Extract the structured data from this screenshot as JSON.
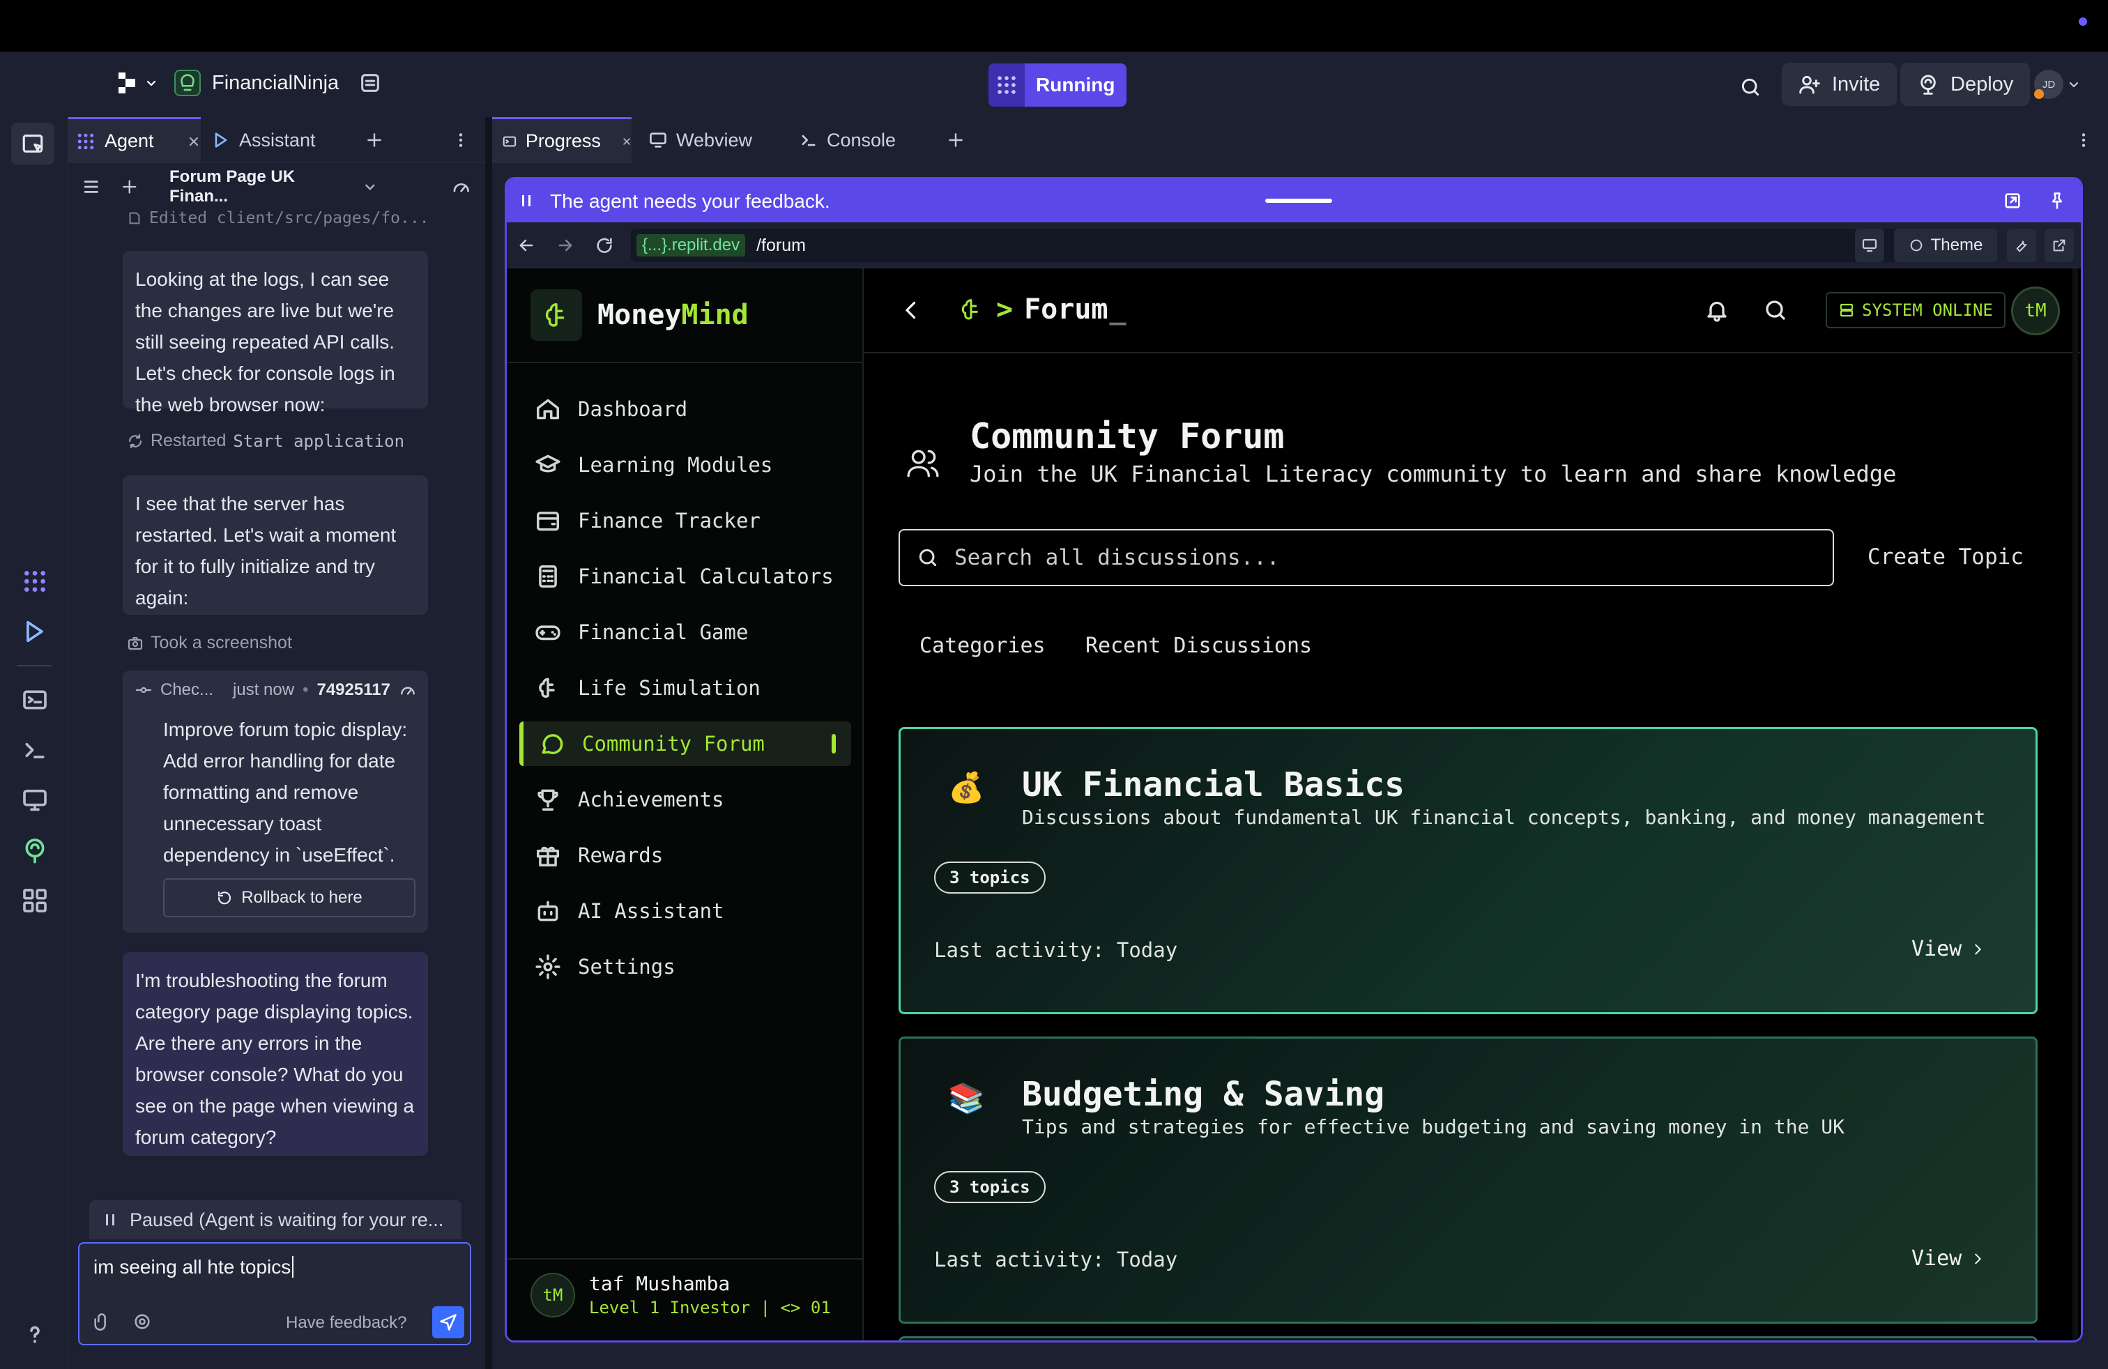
{
  "app": {
    "project_name": "FinancialNinja",
    "status": "Running",
    "invite_label": "Invite",
    "deploy_label": "Deploy",
    "avatar_initials": "JD"
  },
  "chat": {
    "tabs": [
      {
        "label": "Agent"
      },
      {
        "label": "Assistant"
      }
    ],
    "thread_title": "Forum Page UK Finan...",
    "edited_note": "Edited client/src/pages/fo...",
    "messages": [
      {
        "text": "Looking at the logs, I can see the changes are live but we're still seeing repeated API calls. Let's check for console logs in the web browser now:"
      },
      {
        "text": "I see that the server has restarted. Let's wait a moment for it to fully initialize and try again:"
      }
    ],
    "restarted": {
      "prefix": "Restarted",
      "name": "Start application"
    },
    "screenshot_note": "Took a screenshot",
    "checkpoint": {
      "label": "Chec...",
      "time": "just now",
      "id": "74925117",
      "text": "Improve forum topic display: Add error handling for date formatting and remove unnecessary toast dependency in `useEffect`.",
      "rollback_label": "Rollback to here"
    },
    "user_message": "I'm troubleshooting the forum category page displaying topics. Are there any errors in the browser console? What do you see on the page when viewing a forum category?",
    "paused_text": "Paused (Agent is waiting for your re...",
    "input_value": "im seeing all hte topics",
    "feedback_label": "Have feedback?"
  },
  "right_tabs": [
    {
      "label": "Progress"
    },
    {
      "label": "Webview"
    },
    {
      "label": "Console"
    }
  ],
  "preview": {
    "feedback_banner": "The agent needs your feedback.",
    "domain": "{...}.replit.dev",
    "path": "/forum",
    "theme_label": "Theme"
  },
  "webapp": {
    "brand_a": "Money",
    "brand_b": "Mind",
    "nav": [
      {
        "label": "Dashboard",
        "icon": "home-icon"
      },
      {
        "label": "Learning Modules",
        "icon": "graduation-cap-icon"
      },
      {
        "label": "Finance Tracker",
        "icon": "wallet-icon"
      },
      {
        "label": "Financial Calculators",
        "icon": "calculator-icon"
      },
      {
        "label": "Financial Game",
        "icon": "gamepad-icon"
      },
      {
        "label": "Life Simulation",
        "icon": "brain-icon"
      },
      {
        "label": "Community Forum",
        "icon": "message-circle-icon",
        "active": true
      },
      {
        "label": "Achievements",
        "icon": "trophy-icon"
      },
      {
        "label": "Rewards",
        "icon": "gift-icon"
      },
      {
        "label": "AI Assistant",
        "icon": "bot-icon"
      },
      {
        "label": "Settings",
        "icon": "settings-icon"
      }
    ],
    "user": {
      "initials": "tM",
      "name": "taf Mushamba",
      "level": "Level 1 Investor | <> 01"
    },
    "topbar": {
      "prompt": ">",
      "title": "Forum",
      "cursor": "_",
      "status": "SYSTEM ONLINE",
      "avatar": "tM"
    },
    "forum": {
      "title": "Community Forum",
      "subtitle": "Join the UK Financial Literacy community to learn and share knowledge",
      "search_placeholder": "Search all discussions...",
      "create_label": "Create Topic",
      "tabs": [
        "Categories",
        "Recent Discussions"
      ],
      "categories": [
        {
          "emoji": "💰",
          "title": "UK Financial Basics",
          "desc": "Discussions about fundamental UK financial concepts, banking, and money management",
          "topics": "3 topics",
          "activity": "Last activity: Today",
          "view": "View"
        },
        {
          "emoji": "📚",
          "title": "Budgeting & Saving",
          "desc": "Tips and strategies for effective budgeting and saving money in the UK",
          "topics": "3 topics",
          "activity": "Last activity: Today",
          "view": "View"
        }
      ]
    }
  },
  "colors": {
    "accent": "#5b48e8",
    "brand_green": "#a3e635",
    "card_border_active": "#4bd6a3",
    "card_border": "#2f6f5a"
  }
}
